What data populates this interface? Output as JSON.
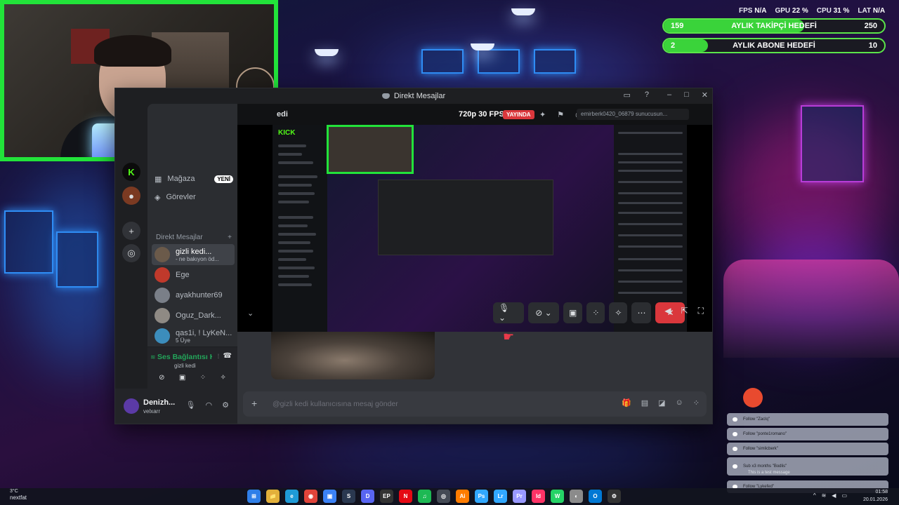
{
  "overlay": {
    "stats": [
      {
        "label": "FPS",
        "value": "N/A"
      },
      {
        "label": "GPU",
        "value": "22 %"
      },
      {
        "label": "CPU",
        "value": "31 %"
      },
      {
        "label": "LAT",
        "value": "N/A"
      }
    ],
    "goals": [
      {
        "current": "159",
        "label": "AYLIK TAKİPÇİ HEDEFİ",
        "target": "250",
        "progress": 0.636
      },
      {
        "current": "2",
        "label": "AYLIK ABONE HEDEFİ",
        "target": "10",
        "progress": 0.2
      }
    ]
  },
  "discord": {
    "window_title": "Direkt Mesajlar",
    "nav": {
      "shop": "Mağaza",
      "shop_badge": "YENİ",
      "quests": "Görevler"
    },
    "dm_header": "Direkt Mesajlar",
    "dm_add": "+",
    "dms": [
      {
        "name": "gizli kedi...",
        "sub": "- ne bakıyon öd...",
        "color": "#6b5a4a",
        "active": true
      },
      {
        "name": "Ege",
        "sub": "",
        "color": "#c0392b",
        "active": false
      },
      {
        "name": "ayakhunter69",
        "sub": "",
        "color": "#7a7f88",
        "active": false
      },
      {
        "name": "Oguz_Dark...",
        "sub": "",
        "color": "#8f8a84",
        "active": false
      },
      {
        "name": "qas1i, ! LyKeN...",
        "sub": "5 Üye",
        "color": "#3c8dbc",
        "active": false
      },
      {
        "name": "qas1i",
        "sub": "",
        "color": "#2aa0c9",
        "active": false
      }
    ],
    "voice": {
      "status": "Ses Bağlantısı K",
      "channel": "gizli kedi"
    },
    "user": {
      "name": "Denizh...",
      "tag": "velxarr"
    },
    "stream": {
      "channel": "edi",
      "quality": "720p 30 FPS",
      "live_badge": "YAYINDA",
      "search_placeholder": "emirberk0420_06879 sunucusun..."
    },
    "inner_stream": {
      "kick_logo": "KICK"
    },
    "composer_placeholder": "@gizli kedi kullanıcısına mesaj gönder"
  },
  "alerts": [
    {
      "text": "Follow \"Zaclq\""
    },
    {
      "text": "Follow \"ponte1romano\""
    },
    {
      "text": "Follow \"simlicberk\""
    },
    {
      "text": "Sub x3 months \"Bodlis\"",
      "note": "This is a test message"
    },
    {
      "text": "Follow \"Lykefed\""
    }
  ],
  "taskbar": {
    "weather": "3°C",
    "status": "nextfat",
    "time": "01:58",
    "date": "20.01.2026",
    "apps": [
      {
        "label": "⊞",
        "color": "#2f7fe8"
      },
      {
        "label": "📁",
        "color": "#e2b03a"
      },
      {
        "label": "e",
        "color": "#1f9bd7"
      },
      {
        "label": "◉",
        "color": "#e0443a"
      },
      {
        "label": "▣",
        "color": "#3b82f6"
      },
      {
        "label": "S",
        "color": "#2a3850"
      },
      {
        "label": "D",
        "color": "#5865f2"
      },
      {
        "label": "EP",
        "color": "#333333"
      },
      {
        "label": "N",
        "color": "#e50914"
      },
      {
        "label": "♫",
        "color": "#1db954"
      },
      {
        "label": "◎",
        "color": "#444a55"
      },
      {
        "label": "Ai",
        "color": "#ff7c00"
      },
      {
        "label": "Ps",
        "color": "#31a8ff"
      },
      {
        "label": "Lr",
        "color": "#31a8ff"
      },
      {
        "label": "Pr",
        "color": "#9999ff"
      },
      {
        "label": "Id",
        "color": "#ff3366"
      },
      {
        "label": "W",
        "color": "#25d366"
      },
      {
        "label": "◐",
        "color": "#8b8b8b"
      },
      {
        "label": "O",
        "color": "#0078d4"
      },
      {
        "label": "⚙",
        "color": "#333333"
      }
    ]
  }
}
